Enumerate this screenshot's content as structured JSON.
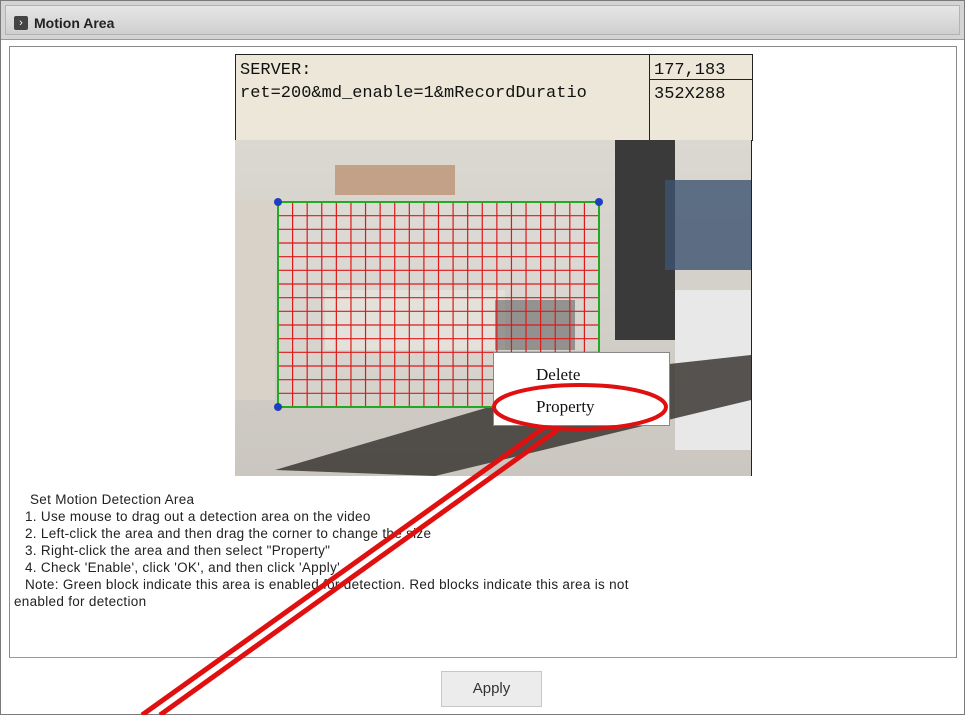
{
  "header": {
    "title": "Motion Area"
  },
  "info": {
    "server_label": "SERVER:",
    "server_response": "ret=200&md_enable=1&mRecordDuratio",
    "coordinates": "177,183",
    "resolution": "352X288"
  },
  "video": {
    "grid_cols": 22,
    "grid_rows": 15,
    "grid_color": "#dd1a1a",
    "border_color": "#22aa22",
    "handle_color": "#1f3fbf"
  },
  "context_menu": {
    "items": [
      {
        "label": "Delete"
      },
      {
        "label": "Property"
      }
    ]
  },
  "instructions": {
    "title": "Set Motion Detection Area",
    "step1": "1. Use mouse to drag out a detection area on the video",
    "step2": "2. Left-click the area and then drag the corner to change the size",
    "step3": "3. Right-click the area and then select \"Property\"",
    "step4": "4. Check 'Enable', click 'OK', and then click 'Apply'",
    "note": "Note: Green block indicate this area is enabled for detection. Red blocks indicate this area is not",
    "note_cont": "enabled for detection"
  },
  "footer": {
    "apply_label": "Apply"
  },
  "annotation": {
    "color": "#e01010"
  }
}
